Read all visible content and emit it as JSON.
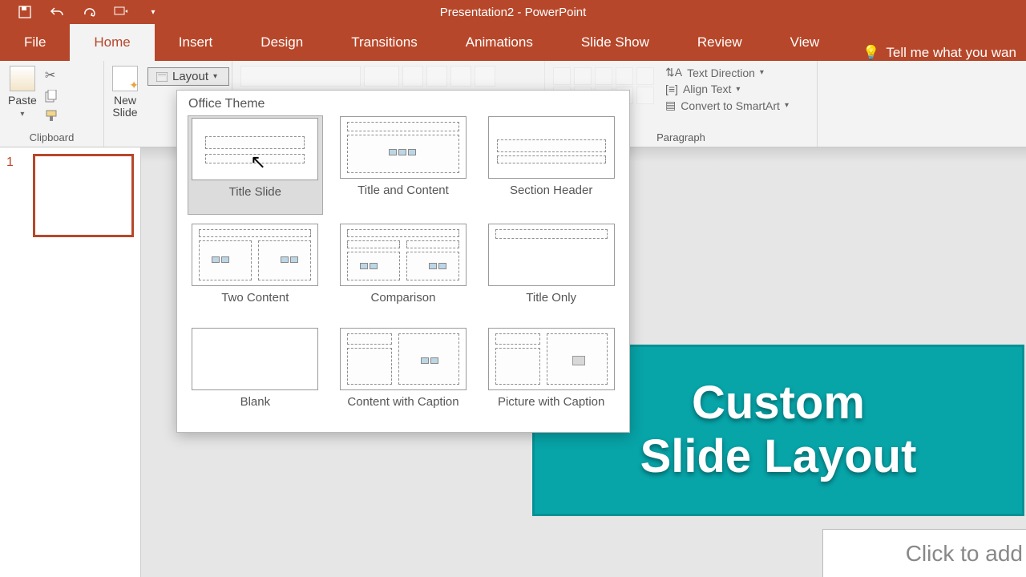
{
  "app": {
    "title": "Presentation2 - PowerPoint"
  },
  "qat": {
    "save": "save-icon",
    "undo": "undo-icon",
    "redo": "redo-icon",
    "start": "start-from-beginning-icon"
  },
  "tabs": {
    "items": [
      {
        "id": "file",
        "label": "File"
      },
      {
        "id": "home",
        "label": "Home"
      },
      {
        "id": "insert",
        "label": "Insert"
      },
      {
        "id": "design",
        "label": "Design"
      },
      {
        "id": "transitions",
        "label": "Transitions"
      },
      {
        "id": "animations",
        "label": "Animations"
      },
      {
        "id": "slideshow",
        "label": "Slide Show"
      },
      {
        "id": "review",
        "label": "Review"
      },
      {
        "id": "view",
        "label": "View"
      }
    ],
    "active": "home",
    "tell_me": "Tell me what you wan"
  },
  "ribbon": {
    "clipboard": {
      "label": "Clipboard",
      "paste": "Paste"
    },
    "slides": {
      "new_slide": "New\nSlide",
      "layout_btn": "Layout"
    },
    "paragraph": {
      "label": "Paragraph",
      "text_direction": "Text Direction",
      "align_text": "Align Text",
      "convert": "Convert to SmartArt"
    }
  },
  "gallery": {
    "header": "Office Theme",
    "items": [
      {
        "id": "title-slide",
        "label": "Title Slide",
        "selected": true
      },
      {
        "id": "title-and-content",
        "label": "Title and Content"
      },
      {
        "id": "section-header",
        "label": "Section Header"
      },
      {
        "id": "two-content",
        "label": "Two Content"
      },
      {
        "id": "comparison",
        "label": "Comparison"
      },
      {
        "id": "title-only",
        "label": "Title Only"
      },
      {
        "id": "blank",
        "label": "Blank"
      },
      {
        "id": "content-caption",
        "label": "Content with Caption"
      },
      {
        "id": "picture-caption",
        "label": "Picture with Caption"
      }
    ]
  },
  "panel": {
    "slides": [
      {
        "num": "1"
      }
    ]
  },
  "banner": {
    "line1": "Custom",
    "line2": "Slide Layout"
  },
  "canvas": {
    "placeholder": "Click to add"
  }
}
